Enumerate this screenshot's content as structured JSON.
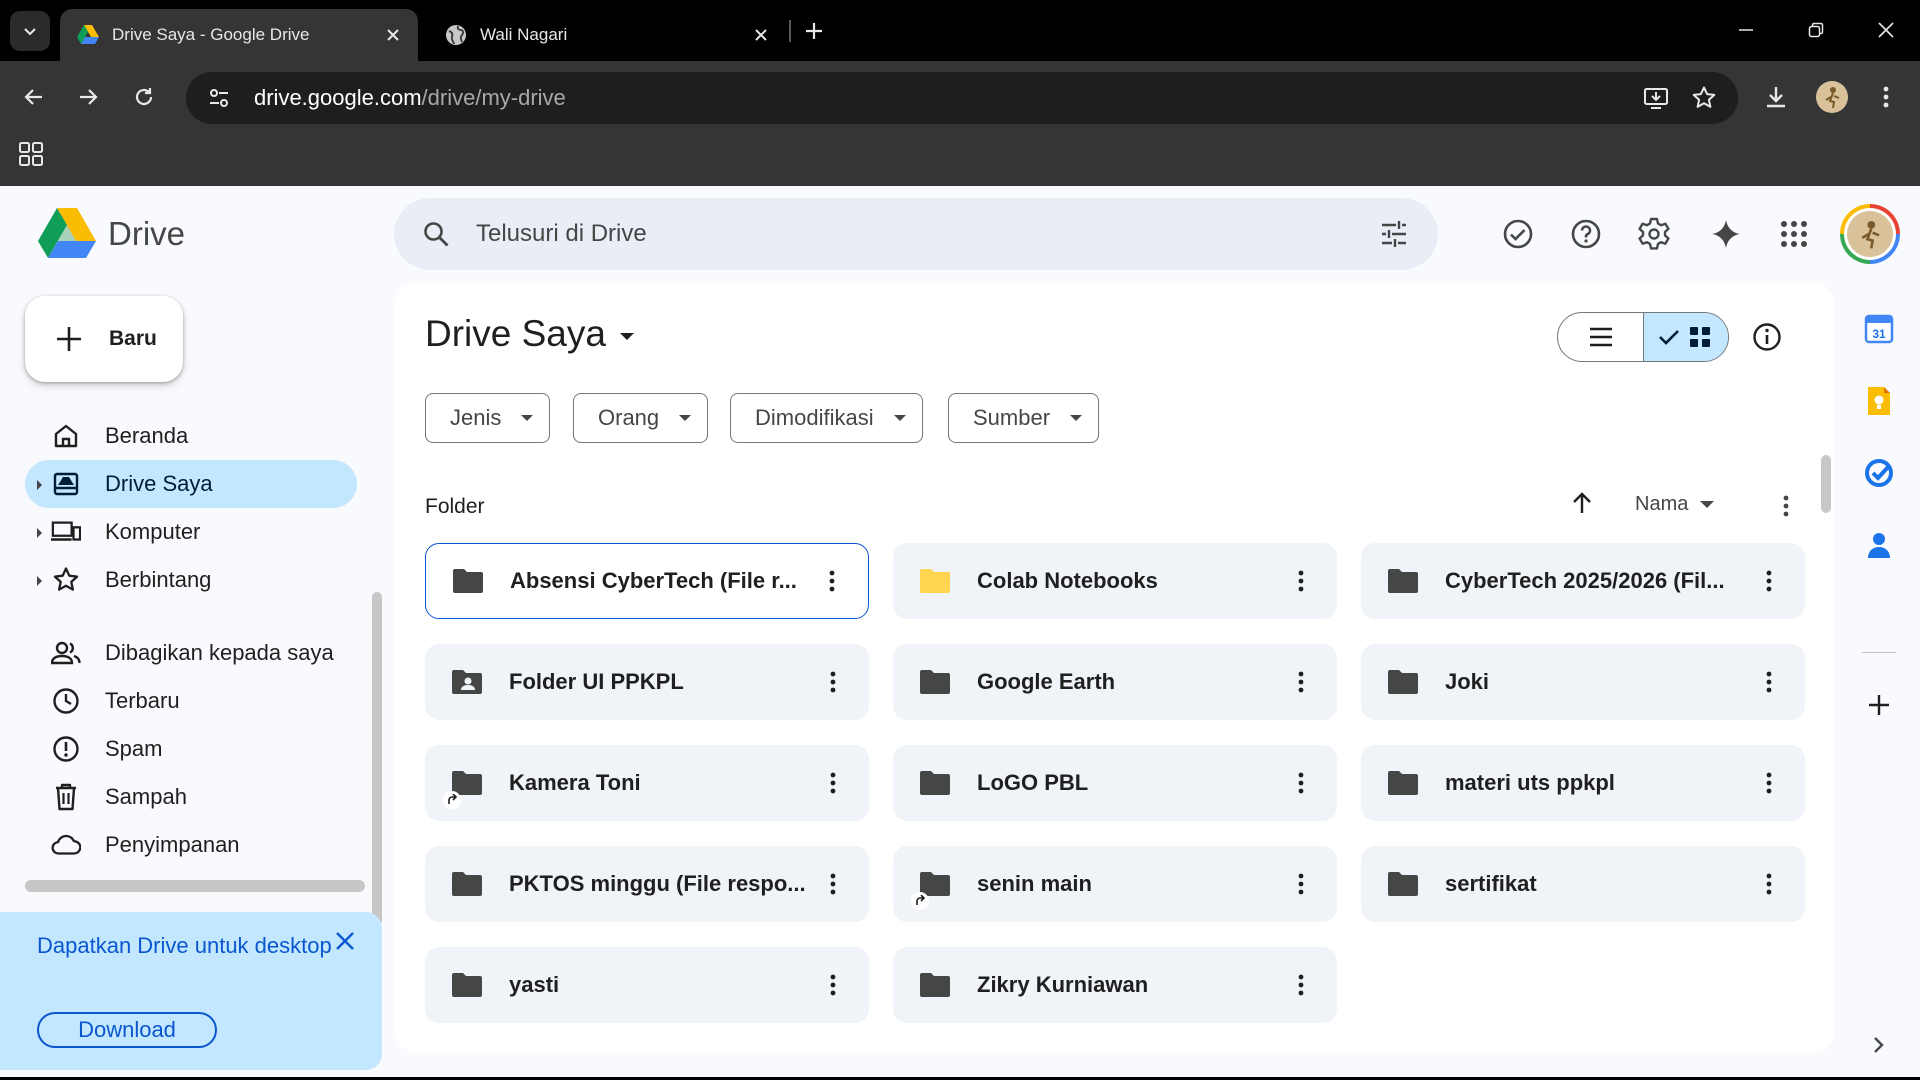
{
  "browser": {
    "tabs": [
      {
        "title": "Drive Saya - Google Drive",
        "favicon": "google-drive-icon",
        "active": true
      },
      {
        "title": "Wali Nagari",
        "favicon": "globe-icon",
        "active": false
      }
    ],
    "url_host": "drive.google.com",
    "url_path": "/drive/my-drive"
  },
  "app": {
    "name": "Drive",
    "search_placeholder": "Telusuri di Drive",
    "new_button": "Baru",
    "nav": [
      {
        "label": "Beranda",
        "icon": "home-icon",
        "caret": false,
        "active": false
      },
      {
        "label": "Drive Saya",
        "icon": "my-drive-icon",
        "caret": true,
        "active": true
      },
      {
        "label": "Komputer",
        "icon": "computer-icon",
        "caret": true,
        "active": false
      },
      {
        "label": "Berbintang",
        "icon": "star-icon",
        "caret": true,
        "active": false
      },
      {
        "label": "Dibagikan kepada saya",
        "icon": "shared-people-icon",
        "caret": false,
        "active": false
      },
      {
        "label": "Terbaru",
        "icon": "clock-icon",
        "caret": false,
        "active": false
      },
      {
        "label": "Spam",
        "icon": "spam-icon",
        "caret": false,
        "active": false
      },
      {
        "label": "Sampah",
        "icon": "trash-icon",
        "caret": false,
        "active": false
      },
      {
        "label": "Penyimpanan",
        "icon": "cloud-icon",
        "caret": false,
        "active": false
      }
    ],
    "promo": {
      "text": "Dapatkan Drive untuk desktop",
      "button": "Download"
    }
  },
  "main": {
    "title": "Drive Saya",
    "filters": [
      "Jenis",
      "Orang",
      "Dimodifikasi",
      "Sumber"
    ],
    "section": "Folder",
    "sort_label": "Nama",
    "folders": [
      {
        "name": "Absensi CyberTech (File r...",
        "type": "folder",
        "selected": true
      },
      {
        "name": "Colab Notebooks",
        "type": "folder-yellow",
        "selected": false
      },
      {
        "name": "CyberTech 2025/2026 (Fil...",
        "type": "folder",
        "selected": false
      },
      {
        "name": "Folder UI PPKPL",
        "type": "folder-shared",
        "selected": false
      },
      {
        "name": "Google Earth",
        "type": "folder",
        "selected": false
      },
      {
        "name": "Joki",
        "type": "folder",
        "selected": false
      },
      {
        "name": "Kamera Toni",
        "type": "folder-shortcut",
        "selected": false
      },
      {
        "name": "LoGO PBL",
        "type": "folder",
        "selected": false
      },
      {
        "name": "materi uts ppkpl",
        "type": "folder",
        "selected": false
      },
      {
        "name": "PKTOS minggu (File respo...",
        "type": "folder",
        "selected": false
      },
      {
        "name": "senin main",
        "type": "folder-shortcut",
        "selected": false
      },
      {
        "name": "sertifikat",
        "type": "folder",
        "selected": false
      },
      {
        "name": "yasti",
        "type": "folder",
        "selected": false
      },
      {
        "name": "Zikry Kurniawan",
        "type": "folder",
        "selected": false
      }
    ]
  },
  "side_panel": {
    "apps": [
      "calendar-icon",
      "keep-icon",
      "tasks-icon",
      "contacts-icon"
    ],
    "calendar_day": "31"
  },
  "colors": {
    "accent": "#0b57d0",
    "active_bg": "#c2e7ff",
    "card_bg": "#f0f4f9",
    "folder_dark": "#444746",
    "folder_yellow": "#ffd54f"
  }
}
